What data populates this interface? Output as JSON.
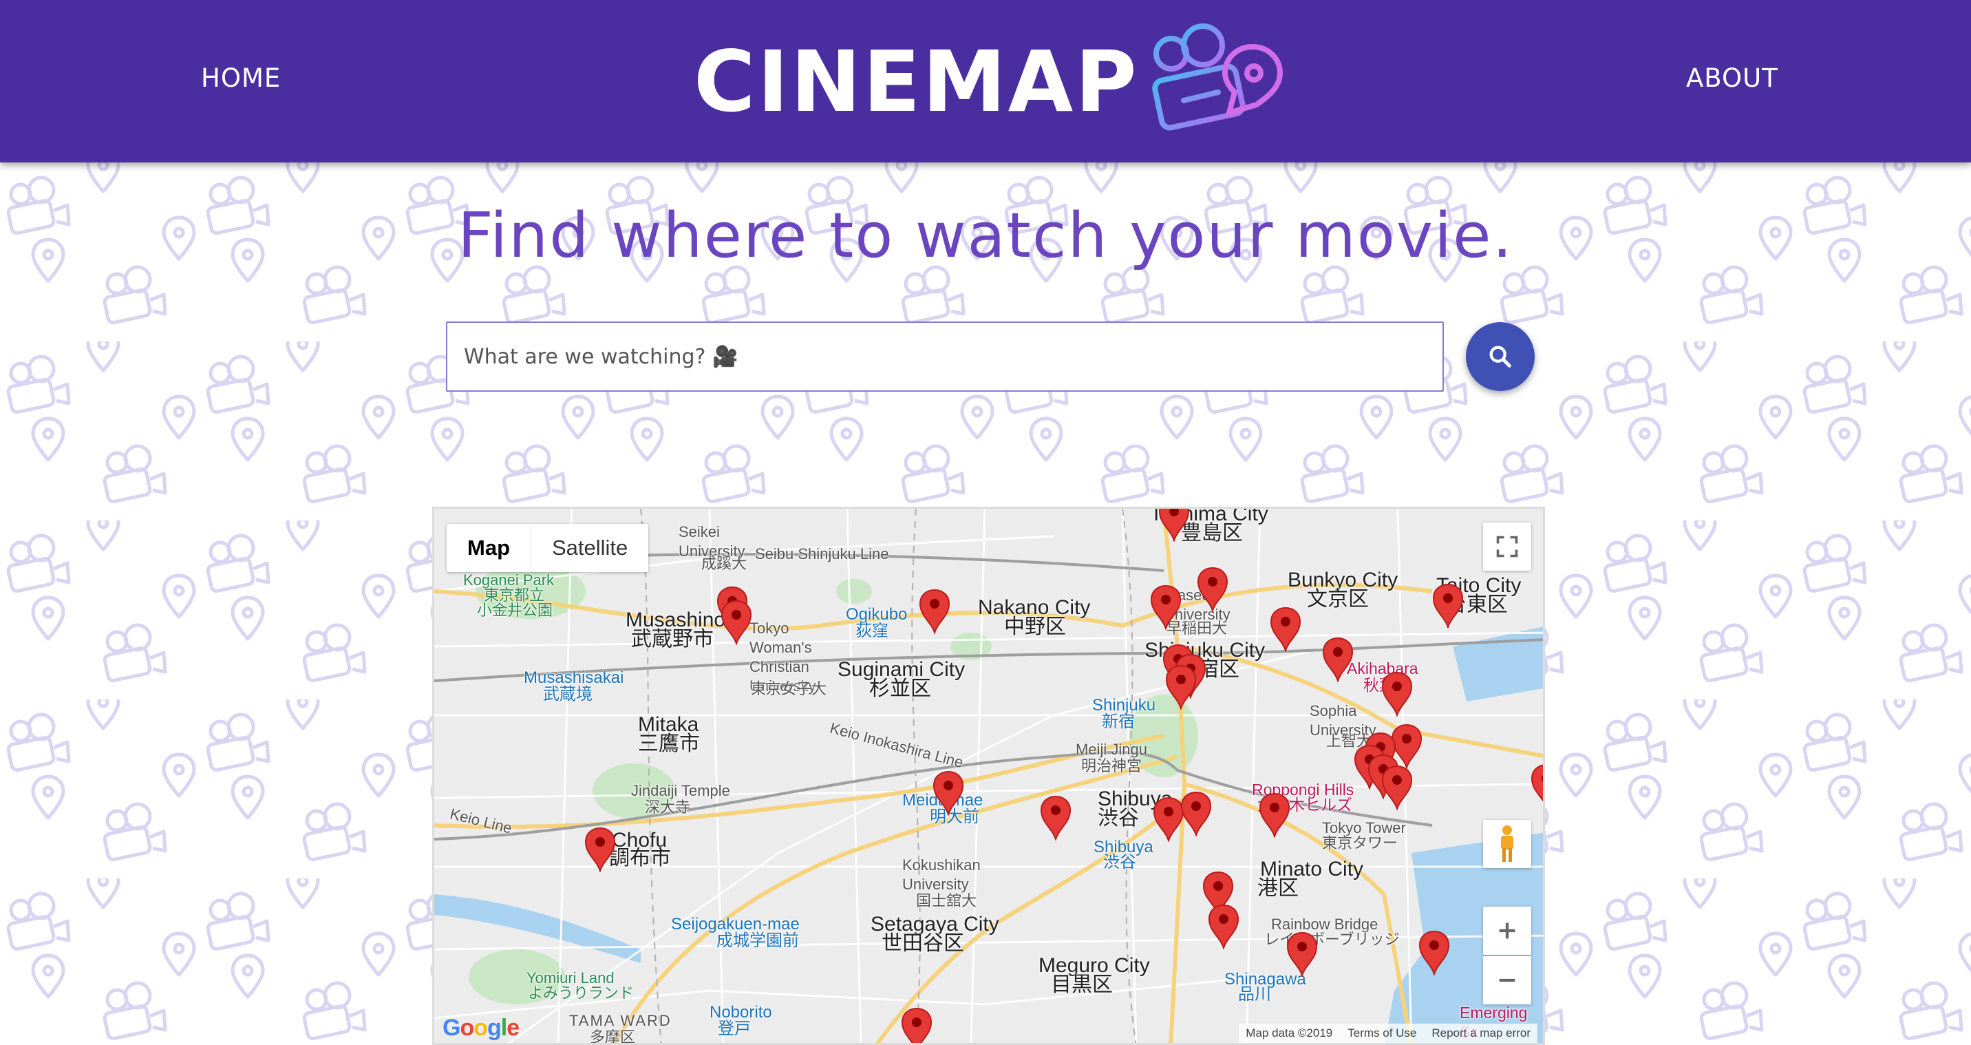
{
  "nav": {
    "home_label": "HOME",
    "about_label": "ABOUT",
    "logo_text": "CINEMAP"
  },
  "colors": {
    "header_bg": "#4a2ea0",
    "headline": "#6a45bf",
    "search_button": "#3f51b5",
    "marker": "#e53935",
    "pattern": "#d9d4f2"
  },
  "headline": "Find where to watch your movie.",
  "search": {
    "placeholder": "What are we watching? 🎥",
    "button_icon": "search-icon"
  },
  "map": {
    "type_buttons": [
      "Map",
      "Satellite"
    ],
    "active_type": "Map",
    "attribution": [
      "Map data ©2019",
      "Terms of Use",
      "Report a map error"
    ],
    "google_logo": "Google",
    "place_labels": [
      "Toshima City",
      "豊島区",
      "Seikei University",
      "成蹊大",
      "Seibu Shinjuku Line",
      "Koganei Park",
      "東京都立",
      "小金井公園",
      "Musashino",
      "武蔵野市",
      "Tokyo Woman's Christian University",
      "東京女子大",
      "Ogikubo",
      "荻窪",
      "Nakano City",
      "中野区",
      "Waseda University",
      "早稲田大",
      "Bunkyo City",
      "文京区",
      "Taito City",
      "台東区",
      "Musashisakai",
      "武蔵境",
      "Suginami City",
      "杉並区",
      "Shinjuku City",
      "新宿区",
      "Akihabara",
      "秋葉原",
      "Shinjuku",
      "新宿",
      "Sophia University",
      "上智大学",
      "Mitaka",
      "三鷹市",
      "Keio Inokashira Line",
      "Meiji Jingu",
      "明治神宮",
      "Jindaiji Temple",
      "深大寺",
      "Meidaimae",
      "明大前",
      "Shibuya",
      "渋谷",
      "Roppongi Hills",
      "六本木ヒルズ",
      "Tokyo Tower",
      "東京タワー",
      "Keio Line",
      "Chofu",
      "調布市",
      "Kokushikan University",
      "国士舘大",
      "Minato City",
      "港区",
      "Shibuya",
      "渋谷",
      "Seijogakuen-mae",
      "成城学園前",
      "Setagaya City",
      "世田谷区",
      "Rainbow Bridge",
      "レインボーブリッジ",
      "Meguro City",
      "目黒区",
      "Yomiuri Land",
      "よみうりランド",
      "Shinagawa",
      "品川",
      "TAMA WARD",
      "多摩区",
      "Noborito",
      "登戸",
      "Emerging Sc"
    ]
  }
}
